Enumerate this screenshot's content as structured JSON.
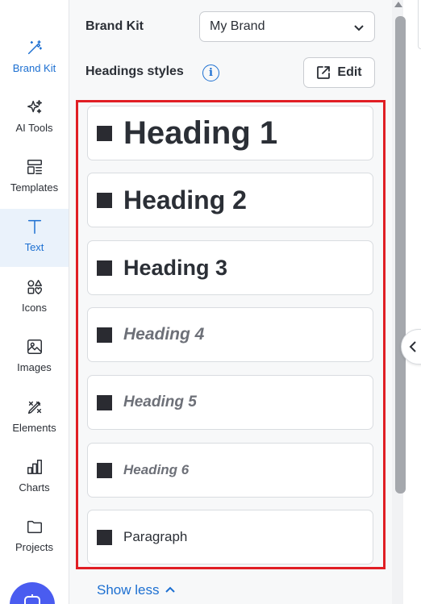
{
  "rail": {
    "items": [
      {
        "label": "Brand Kit",
        "icon": "magic-wand-icon"
      },
      {
        "label": "AI Tools",
        "icon": "sparkles-icon"
      },
      {
        "label": "Templates",
        "icon": "templates-icon"
      },
      {
        "label": "Text",
        "icon": "text-icon"
      },
      {
        "label": "Icons",
        "icon": "shapes-icon"
      },
      {
        "label": "Images",
        "icon": "image-icon"
      },
      {
        "label": "Elements",
        "icon": "elements-icon"
      },
      {
        "label": "Charts",
        "icon": "bar-chart-icon"
      },
      {
        "label": "Projects",
        "icon": "folder-icon"
      }
    ],
    "active": "Text",
    "accent_color": "#1c6fd1"
  },
  "panel": {
    "brand_kit_label": "Brand Kit",
    "brand_select_value": "My Brand",
    "headings_label": "Headings styles",
    "info_glyph": "i",
    "edit_label": "Edit",
    "styles": [
      {
        "label": "Heading 1"
      },
      {
        "label": "Heading 2"
      },
      {
        "label": "Heading 3"
      },
      {
        "label": "Heading 4"
      },
      {
        "label": "Heading 5"
      },
      {
        "label": "Heading 6"
      },
      {
        "label": "Paragraph"
      }
    ],
    "show_less_label": "Show less"
  },
  "colors": {
    "selection_frame": "#e01e24",
    "link": "#1c6fd1",
    "swatch": "#2a2b31",
    "bot_button": "#4a5cf0"
  }
}
